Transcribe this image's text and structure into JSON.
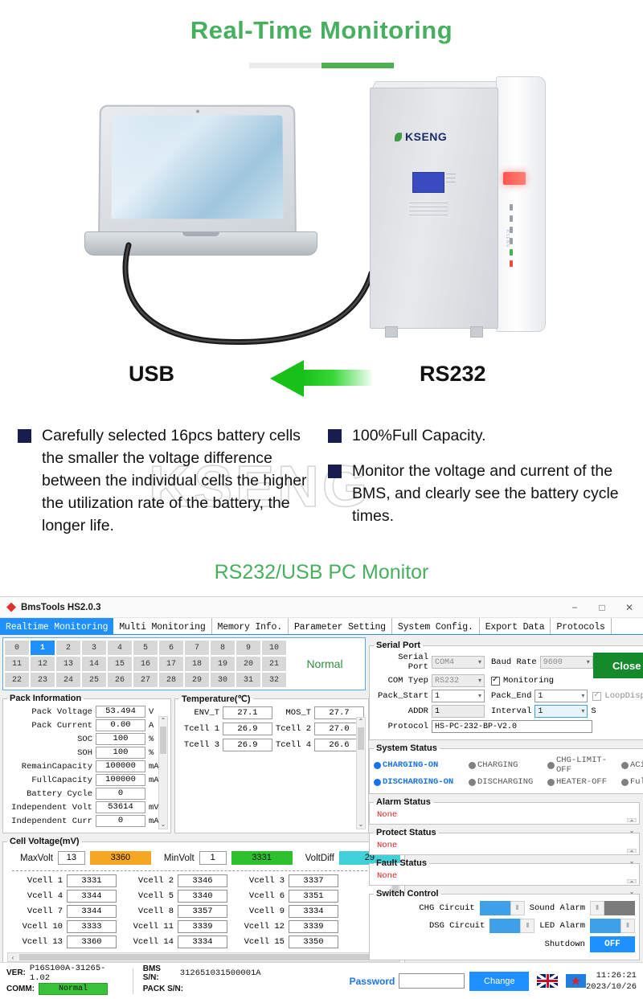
{
  "promo": {
    "title": "Real-Time Monitoring",
    "usb_label": "USB",
    "rs232_label": "RS232",
    "watermark": "KSENG",
    "brand": "KSENG",
    "subtitle": "RS232/USB PC Monitor",
    "bullets_left": [
      "Carefully selected 16pcs battery cells the smaller the voltage difference between the individual cells the higher the utilization rate of the battery, the longer life."
    ],
    "bullets_right": [
      "100%Full Capacity.",
      "Monitor the voltage and current of the BMS, and clearly see the battery cycle times."
    ]
  },
  "app": {
    "window_title": "BmsTools HS2.0.3",
    "window_buttons": {
      "minimize": "−",
      "maximize": "□",
      "close": "✕"
    },
    "tabs": [
      {
        "label": "Realtime Monitoring",
        "active": true
      },
      {
        "label": "Multi Monitoring",
        "active": false
      },
      {
        "label": "Memory Info.",
        "active": false
      },
      {
        "label": "Parameter Setting",
        "active": false
      },
      {
        "label": "System Config.",
        "active": false
      },
      {
        "label": "Export Data",
        "active": false
      },
      {
        "label": "Protocols",
        "active": false
      }
    ],
    "pack_selector": {
      "rows": [
        [
          "0",
          "1",
          "2",
          "3",
          "4",
          "5",
          "6",
          "7",
          "8",
          "9",
          "10"
        ],
        [
          "11",
          "12",
          "13",
          "14",
          "15",
          "16",
          "17",
          "18",
          "19",
          "20",
          "21"
        ],
        [
          "22",
          "23",
          "24",
          "25",
          "26",
          "27",
          "28",
          "29",
          "30",
          "31",
          "32"
        ]
      ],
      "selected": "1",
      "status": "Normal"
    },
    "pack_information": {
      "legend": "Pack Information",
      "rows": [
        {
          "label": "Pack Voltage",
          "value": "53.494",
          "unit": "V"
        },
        {
          "label": "Pack Current",
          "value": "0.00",
          "unit": "A"
        },
        {
          "label": "SOC",
          "value": "100",
          "unit": "%"
        },
        {
          "label": "SOH",
          "value": "100",
          "unit": "%"
        },
        {
          "label": "RemainCapacity",
          "value": "100000",
          "unit": "mAH"
        },
        {
          "label": "FullCapacity",
          "value": "100000",
          "unit": "mAH"
        },
        {
          "label": "Battery Cycle",
          "value": "0",
          "unit": ""
        },
        {
          "label": "Independent Volt",
          "value": "53614",
          "unit": "mV"
        },
        {
          "label": "Independent Curr",
          "value": "0",
          "unit": "mA"
        }
      ]
    },
    "temperature": {
      "legend": "Temperature(℃)",
      "rows": [
        {
          "l1": "ENV_T",
          "v1": "27.1",
          "l2": "MOS_T",
          "v2": "27.7"
        },
        {
          "l1": "Tcell 1",
          "v1": "26.9",
          "l2": "Tcell 2",
          "v2": "27.0"
        },
        {
          "l1": "Tcell 3",
          "v1": "26.9",
          "l2": "Tcell 4",
          "v2": "26.6"
        }
      ]
    },
    "cell_voltage": {
      "legend": "Cell Voltage(mV)",
      "maxvolt_label": "MaxVolt",
      "maxvolt_index": "13",
      "maxvolt_value": "3360",
      "minvolt_label": "MinVolt",
      "minvolt_index": "1",
      "minvolt_value": "3331",
      "voltdiff_label": "VoltDiff",
      "voltdiff_value": "29",
      "cells": [
        {
          "label": "Vcell 1",
          "value": "3331"
        },
        {
          "label": "Vcell 2",
          "value": "3346"
        },
        {
          "label": "Vcell 3",
          "value": "3337"
        },
        {
          "label": "Vcell 4",
          "value": "3344"
        },
        {
          "label": "Vcell 5",
          "value": "3340"
        },
        {
          "label": "Vcell 6",
          "value": "3351"
        },
        {
          "label": "Vcell 7",
          "value": "3344"
        },
        {
          "label": "Vcell 8",
          "value": "3357"
        },
        {
          "label": "Vcell 9",
          "value": "3334"
        },
        {
          "label": "Vcell 10",
          "value": "3333"
        },
        {
          "label": "Vcell 11",
          "value": "3339"
        },
        {
          "label": "Vcell 12",
          "value": "3339"
        },
        {
          "label": "Vcell 13",
          "value": "3360"
        },
        {
          "label": "Vcell 14",
          "value": "3334"
        },
        {
          "label": "Vcell 15",
          "value": "3350"
        }
      ]
    },
    "serial_port": {
      "legend": "Serial Port",
      "serial_port_label": "Serial Port",
      "serial_port_value": "COM4",
      "baud_rate_label": "Baud Rate",
      "baud_rate_value": "9600",
      "com_type_label": "COM Tyep",
      "com_type_value": "RS232",
      "monitoring_label": "Monitoring",
      "monitoring_checked": true,
      "pack_start_label": "Pack_Start",
      "pack_start_value": "1",
      "pack_end_label": "Pack_End",
      "pack_end_value": "1",
      "loopdisplay_label": "LoopDisplay",
      "loopdisplay_checked": true,
      "addr_label": "ADDR",
      "addr_value": "1",
      "interval_label": "Interval",
      "interval_value": "1",
      "interval_unit": "S",
      "protocol_label": "Protocol",
      "protocol_value": "HS-PC-232-BP-V2.0",
      "close_button": "Close"
    },
    "system_status": {
      "legend": "System Status",
      "row1": [
        {
          "label": "CHARGING-ON",
          "on": true
        },
        {
          "label": "CHARGING",
          "on": false
        },
        {
          "label": "CHG-LIMIT-OFF",
          "on": false
        },
        {
          "label": "ACin",
          "on": false
        }
      ],
      "row2": [
        {
          "label": "DISCHARGING-ON",
          "on": true
        },
        {
          "label": "DISCHARGING",
          "on": false
        },
        {
          "label": "HEATER-OFF",
          "on": false
        },
        {
          "label": "Fully",
          "on": false
        }
      ]
    },
    "alarm_status": {
      "legend": "Alarm Status",
      "value": "None"
    },
    "protect_status": {
      "legend": "Protect Status",
      "value": "None"
    },
    "fault_status": {
      "legend": "Fault Status",
      "value": "None"
    },
    "switch_control": {
      "legend": "Switch Control",
      "chg_label": "CHG Circuit",
      "chg_on": true,
      "dsg_label": "DSG Circuit",
      "dsg_on": true,
      "sound_label": "Sound Alarm",
      "sound_on": false,
      "led_label": "LED Alarm",
      "led_on": true,
      "shutdown_label": "Shutdown",
      "shutdown_value": "OFF"
    },
    "status_bar": {
      "ver_key": "VER:",
      "ver_value": "P16S100A-31265-1.02",
      "comm_key": "COMM:",
      "comm_value": "Normal",
      "bms_sn_key": "BMS S/N:",
      "bms_sn_value": "312651031500001A",
      "pack_sn_key": "PACK S/N:",
      "pack_sn_value": "",
      "password_label": "Password",
      "password_value": "",
      "change_button": "Change",
      "time": "11:26:21",
      "date": "2023/10/26"
    }
  }
}
